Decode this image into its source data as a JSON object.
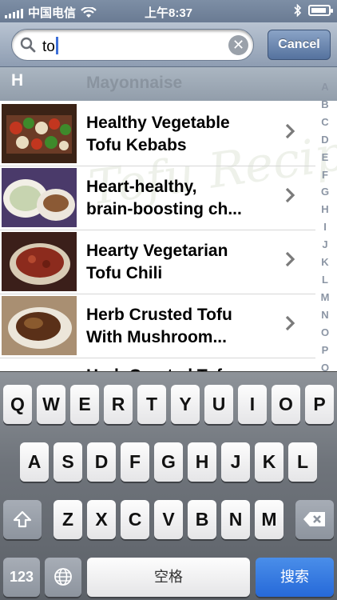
{
  "status_bar": {
    "carrier": "中国电信",
    "time": "上午8:37"
  },
  "search": {
    "value": "to",
    "cancel_label": "Cancel"
  },
  "section": {
    "letter": "H",
    "ghost_label": "Mayonnaise"
  },
  "watermark": "Tofu Recipes",
  "recipes": [
    {
      "title": "Healthy Vegetable\nTofu Kebabs"
    },
    {
      "title": "Heart-healthy,\nbrain-boosting ch..."
    },
    {
      "title": "Hearty Vegetarian\nTofu Chili"
    },
    {
      "title": "Herb Crusted Tofu\nWith Mushroom..."
    },
    {
      "title": "Herb Crusted Tofu"
    }
  ],
  "index_letters": [
    "A",
    "B",
    "C",
    "D",
    "E",
    "F",
    "G",
    "H",
    "I",
    "J",
    "K",
    "L",
    "M",
    "N",
    "O",
    "P",
    "Q"
  ],
  "keyboard": {
    "row1": [
      "Q",
      "W",
      "E",
      "R",
      "T",
      "Y",
      "U",
      "I",
      "O",
      "P"
    ],
    "row2": [
      "A",
      "S",
      "D",
      "F",
      "G",
      "H",
      "J",
      "K",
      "L"
    ],
    "row3": [
      "Z",
      "X",
      "C",
      "V",
      "B",
      "N",
      "M"
    ],
    "numbers_label": "123",
    "space_label": "空格",
    "search_label": "搜索"
  },
  "colors": {
    "accent": "#2669d9",
    "bar": "#8e9db2"
  }
}
